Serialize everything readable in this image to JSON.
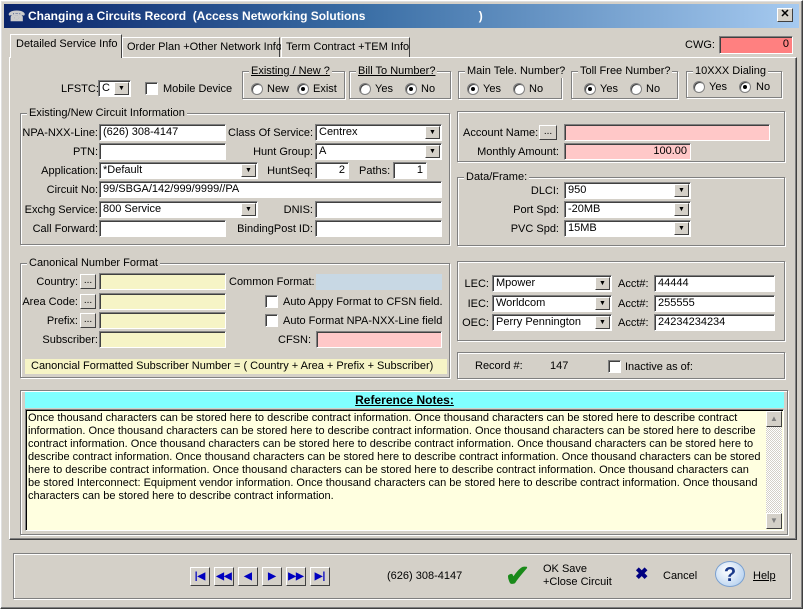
{
  "window": {
    "title": "Changing a Circuits Record  (Access Networking Solutions                                  )",
    "close_label": "✕",
    "app_icon": "telephone-icon"
  },
  "tabs": [
    {
      "label": "Detailed Service Info",
      "active": true
    },
    {
      "label": "Order Plan +Other Network Info",
      "active": false
    },
    {
      "label": "Term Contract +TEM Info",
      "active": false
    }
  ],
  "cwg": {
    "label": "CWG:",
    "value": "0"
  },
  "top_row": {
    "lfstc_label": "LFSTC:",
    "lfstc_value": "C",
    "mobile_device_label": "Mobile Device",
    "mobile_device_checked": false,
    "existing_new": {
      "title": "Existing / New ?",
      "options": [
        "New",
        "Exist"
      ],
      "selected": "Exist"
    },
    "bill_to_number": {
      "title": "Bill To Number?",
      "options": [
        "Yes",
        "No"
      ],
      "selected": "No"
    },
    "main_tele_number": {
      "title": "Main Tele. Number?",
      "options": [
        "Yes",
        "No"
      ],
      "selected": "Yes"
    },
    "toll_free_number": {
      "title": "Toll Free Number?",
      "options": [
        "Yes",
        "No"
      ],
      "selected": "Yes"
    },
    "ten_xxx_dialing": {
      "title": "10XXX Dialing",
      "options": [
        "Yes",
        "No"
      ],
      "selected": "No"
    }
  },
  "circuit_info": {
    "title": "Existing/New Circuit Information",
    "npa_nxx_line": {
      "label": "NPA-NXX-Line:",
      "value": "(626) 308-4147"
    },
    "ptn": {
      "label": "PTN:",
      "value": ""
    },
    "application": {
      "label": "Application:",
      "value": "*Default"
    },
    "circuit_no": {
      "label": "Circuit No:",
      "value": "99/SBGA/142/999/9999//PA"
    },
    "exchg_service": {
      "label": "Exchg Service:",
      "value": "800 Service"
    },
    "call_forward": {
      "label": "Call Forward:",
      "value": ""
    },
    "class_of_service": {
      "label": "Class Of Service:",
      "value": "Centrex"
    },
    "hunt_group": {
      "label": "Hunt Group:",
      "value": "A"
    },
    "hunt_seq": {
      "label": "HuntSeq:",
      "value": "2"
    },
    "paths": {
      "label": "Paths:",
      "value": "1"
    },
    "dnis": {
      "label": "DNIS:",
      "value": ""
    },
    "binding_post_id": {
      "label": "BindingPost ID:",
      "value": ""
    }
  },
  "account": {
    "account_name": {
      "label": "Account Name:",
      "value": "",
      "browse_label": "..."
    },
    "monthly_amount": {
      "label": "Monthly Amount:",
      "value": "100.00"
    }
  },
  "data_frame": {
    "title": "Data/Frame:",
    "dlci": {
      "label": "DLCI:",
      "value": "950"
    },
    "port_spd": {
      "label": "Port Spd:",
      "value": "-20MB"
    },
    "pvc_spd": {
      "label": "PVC Spd:",
      "value": "15MB"
    }
  },
  "canonical": {
    "title": "Canonical Number Format",
    "country": {
      "label": "Country:",
      "value": ""
    },
    "area_code": {
      "label": "Area Code:",
      "value": ""
    },
    "prefix": {
      "label": "Prefix:",
      "value": ""
    },
    "subscriber": {
      "label": "Subscriber:",
      "value": ""
    },
    "browse_label": "...",
    "common_format": {
      "label": "Common Format:",
      "value": ""
    },
    "auto_apply_label": "Auto Appy Format to CFSN field.",
    "auto_apply_checked": false,
    "auto_format_label": "Auto Format NPA-NXX-Line field",
    "auto_format_checked": false,
    "cfsn": {
      "label": "CFSN:",
      "value": ""
    },
    "formula": "Canoncial Formatted Subscriber Number =  ( Country + Area + Prefix + Subscriber)"
  },
  "carriers": {
    "lec": {
      "label": "LEC:",
      "value": "Mpower",
      "acct_label": "Acct#:",
      "acct": "44444"
    },
    "iec": {
      "label": "IEC:",
      "value": "Worldcom",
      "acct_label": "Acct#:",
      "acct": "255555"
    },
    "oec": {
      "label": "OEC:",
      "value": "Perry Pennington",
      "acct_label": "Acct#:",
      "acct": "24234234234"
    }
  },
  "record": {
    "label": "Record #:",
    "value": "147",
    "inactive_label": "Inactive as of:",
    "inactive_checked": false
  },
  "notes": {
    "title": "Reference Notes:",
    "text": "Once thousand characters can be stored here to describe contract information. Once thousand characters can be stored here to describe contract information. Once thousand characters can be stored here to describe contract information. Once thousand characters can be stored here to describe contract information. Once thousand characters can be stored here to describe contract information. Once thousand characters can be stored here to describe contract information. Once thousand characters can be stored here to describe contract information. Once thousand characters can be stored here to describe contract information. Once thousand characters can be stored here to describe contract information. Once thousand characters can be stored Interconnect: Equipment vendor information. Once thousand characters can be stored here to describe contract information. Once thousand characters can be stored here to describe contract information."
  },
  "footer": {
    "nav_buttons": [
      "first",
      "prev-page",
      "prev",
      "next",
      "next-page",
      "last"
    ],
    "current_number": "(626) 308-4147",
    "ok_line1": "OK Save",
    "ok_line2": "+Close Circuit",
    "cancel_label": "Cancel",
    "help_label": "Help",
    "accent_ok": "#1a8a1a",
    "accent_cancel": "#000080"
  }
}
